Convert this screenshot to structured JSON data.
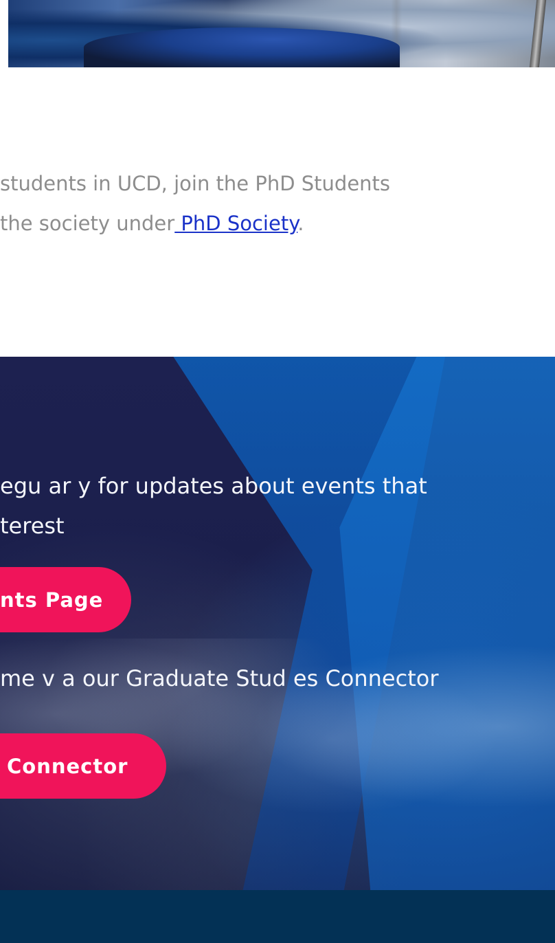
{
  "intro": {
    "line1": "students in UCD, join the PhD Students",
    "line2_prefix": " the society under",
    "link_text": " PhD Society",
    "line2_suffix": "."
  },
  "promo": {
    "text1_line1": "egu ar y for updates about events that",
    "text1_line2": "terest",
    "events_button": "nts Page",
    "text2": "me v a our Graduate Stud es Connector",
    "connector_button": "Connector"
  },
  "colors": {
    "accent": "#f0145a",
    "link": "#1a32c8",
    "footer": "#033155",
    "promo_bg": "#1b1f4d"
  }
}
